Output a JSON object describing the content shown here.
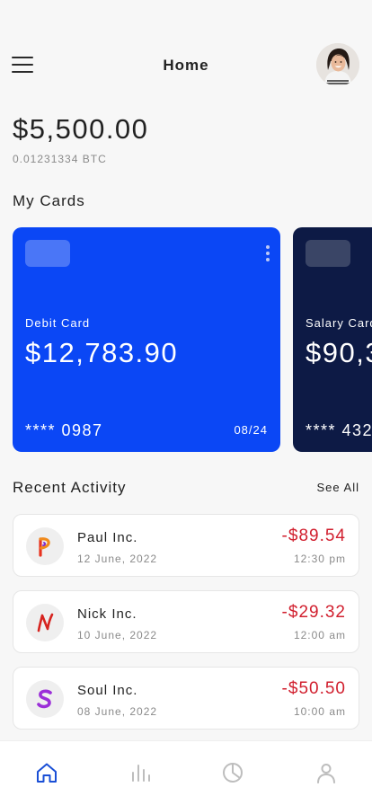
{
  "header": {
    "title": "Home",
    "menu_icon": "hamburger-menu-icon",
    "avatar": "user-avatar"
  },
  "balance": {
    "amount": "$5,500.00",
    "btc": "0.01231334 BTC"
  },
  "cards_section": {
    "title": "My Cards",
    "cards": [
      {
        "type": "Debit Card",
        "amount": "$12,783.90",
        "number": "**** 0987",
        "expiry": "08/24",
        "color": "#0b47f5"
      },
      {
        "type": "Salary Card",
        "amount": "$90,3",
        "number": "**** 432",
        "expiry": "",
        "color": "#0d1a45"
      }
    ]
  },
  "activity": {
    "title": "Recent Activity",
    "see_all": "See All",
    "items": [
      {
        "name": "Paul Inc.",
        "date": "12 June, 2022",
        "amount": "-$89.54",
        "time": "12:30 pm",
        "icon": "paul-logo-icon"
      },
      {
        "name": "Nick Inc.",
        "date": "10 June, 2022",
        "amount": "-$29.32",
        "time": "12:00 am",
        "icon": "nick-logo-icon"
      },
      {
        "name": "Soul Inc.",
        "date": "08 June, 2022",
        "amount": "-$50.50",
        "time": "10:00 am",
        "icon": "soul-logo-icon"
      }
    ]
  },
  "tabbar": {
    "active_color": "#1a4fd6",
    "inactive_color": "#bdbdbd",
    "tabs": [
      {
        "icon": "home-icon",
        "active": true
      },
      {
        "icon": "bar-chart-icon",
        "active": false
      },
      {
        "icon": "pie-chart-icon",
        "active": false
      },
      {
        "icon": "profile-icon",
        "active": false
      }
    ]
  }
}
